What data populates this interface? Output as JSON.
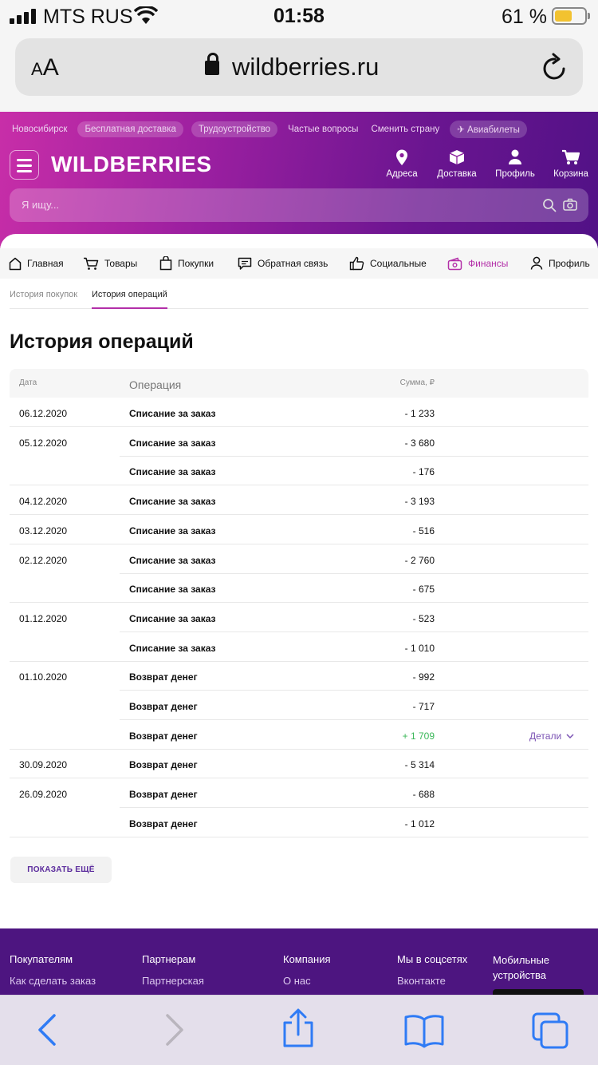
{
  "status_bar": {
    "carrier": "MTS RUS",
    "time": "01:58",
    "battery_percent": "61 %",
    "battery_level": 0.61
  },
  "browser": {
    "aa_label": "AA",
    "url": "wildberries.ru"
  },
  "header": {
    "city": "Новосибирск",
    "top_links": [
      "Бесплатная доставка",
      "Трудоустройство",
      "Частые вопросы",
      "Сменить страну",
      "Авиабилеты"
    ],
    "logo": "WILDBERRIES",
    "nav": [
      {
        "label": "Адреса",
        "icon": "location-pin-icon"
      },
      {
        "label": "Доставка",
        "icon": "box-icon"
      },
      {
        "label": "Профиль",
        "icon": "user-icon"
      },
      {
        "label": "Корзина",
        "icon": "cart-icon"
      }
    ],
    "search_placeholder": "Я ищу..."
  },
  "account_nav": [
    {
      "label": "Главная",
      "icon": "home-icon",
      "active": false
    },
    {
      "label": "Товары",
      "icon": "cart-icon",
      "active": false
    },
    {
      "label": "Покупки",
      "icon": "bag-icon",
      "active": false
    },
    {
      "label": "Обратная связь",
      "icon": "chat-icon",
      "active": false
    },
    {
      "label": "Социальные",
      "icon": "thumbs-up-icon",
      "active": false
    },
    {
      "label": "Финансы",
      "icon": "wallet-icon",
      "active": true
    },
    {
      "label": "Профиль",
      "icon": "user-icon",
      "active": false
    }
  ],
  "subtabs": [
    "История покупок",
    "История операций"
  ],
  "page_title": "История операций",
  "table": {
    "headers": {
      "date": "Дата",
      "operation": "Операция",
      "sum": "Сумма, ₽"
    },
    "rows": [
      {
        "date": "06.12.2020",
        "operation": "Списание за заказ",
        "sum": "- 1 233"
      },
      {
        "date": "05.12.2020",
        "operation": "Списание за заказ",
        "sum": "- 3 680"
      },
      {
        "date": "",
        "operation": "Списание за заказ",
        "sum": "- 176"
      },
      {
        "date": "04.12.2020",
        "operation": "Списание за заказ",
        "sum": "- 3 193"
      },
      {
        "date": "03.12.2020",
        "operation": "Списание за заказ",
        "sum": "- 516"
      },
      {
        "date": "02.12.2020",
        "operation": "Списание за заказ",
        "sum": "- 2 760"
      },
      {
        "date": "",
        "operation": "Списание за заказ",
        "sum": "- 675"
      },
      {
        "date": "01.12.2020",
        "operation": "Списание за заказ",
        "sum": "- 523"
      },
      {
        "date": "",
        "operation": "Списание за заказ",
        "sum": "- 1 010"
      },
      {
        "date": "01.10.2020",
        "operation": "Возврат денег",
        "sum": "- 992"
      },
      {
        "date": "",
        "operation": "Возврат денег",
        "sum": "- 717"
      },
      {
        "date": "",
        "operation": "Возврат денег",
        "sum": "+ 1 709",
        "positive": true,
        "details": "Детали"
      },
      {
        "date": "30.09.2020",
        "operation": "Возврат денег",
        "sum": "- 5 314"
      },
      {
        "date": "26.09.2020",
        "operation": "Возврат денег",
        "sum": "- 688"
      },
      {
        "date": "",
        "operation": "Возврат денег",
        "sum": "- 1 012"
      }
    ]
  },
  "show_more_label": "ПОКАЗАТЬ ЕЩЁ",
  "footer": {
    "columns": [
      {
        "title": "Покупателям",
        "link": "Как сделать заказ"
      },
      {
        "title": "Партнерам",
        "link": "Партнерская"
      },
      {
        "title": "Компания",
        "link": "О нас"
      },
      {
        "title": "Мы в соцсетях",
        "link": "Вконтакте"
      },
      {
        "title": "Мобильные устройства",
        "link": ""
      }
    ]
  },
  "colors": {
    "brand_start": "#c82ea8",
    "brand_end": "#511186",
    "accent": "#b32fa8",
    "positive": "#3cb85a",
    "ios_blue": "#2f7bf5"
  }
}
